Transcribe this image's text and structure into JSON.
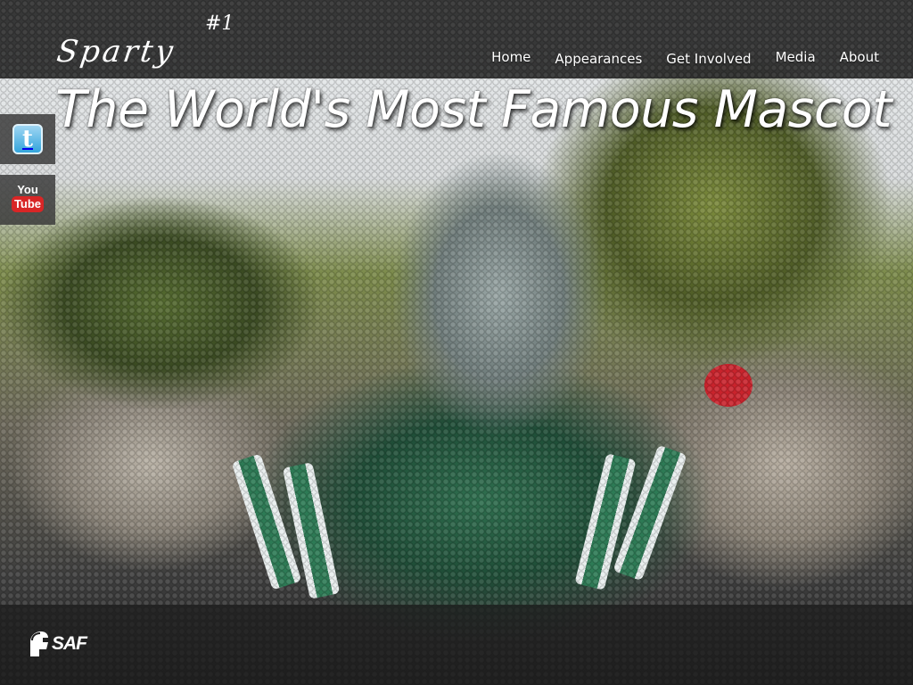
{
  "site": {
    "logo_text": "Sparty",
    "logo_badge": "#1"
  },
  "nav": {
    "items": [
      {
        "label": "Home"
      },
      {
        "label": "Appearances"
      },
      {
        "label": "Get Involved"
      },
      {
        "label": "Media"
      },
      {
        "label": "About"
      }
    ]
  },
  "hero": {
    "headline": "The World's Most Famous Mascot",
    "background_description_colors": {
      "green": "#2d7a55",
      "sign_red": "#c9232c"
    }
  },
  "social": {
    "twitter_glyph": "t",
    "youtube_top": "You",
    "youtube_bottom": "Tube",
    "icons": [
      "twitter-icon",
      "youtube-icon"
    ]
  },
  "footer": {
    "logo_text": "SAF",
    "logo_icon": "spartan-helmet-icon"
  },
  "colors": {
    "header_bg": "#282828",
    "text": "#ffffff",
    "twitter_blue": "#33a5dc",
    "youtube_red": "#d82626"
  }
}
